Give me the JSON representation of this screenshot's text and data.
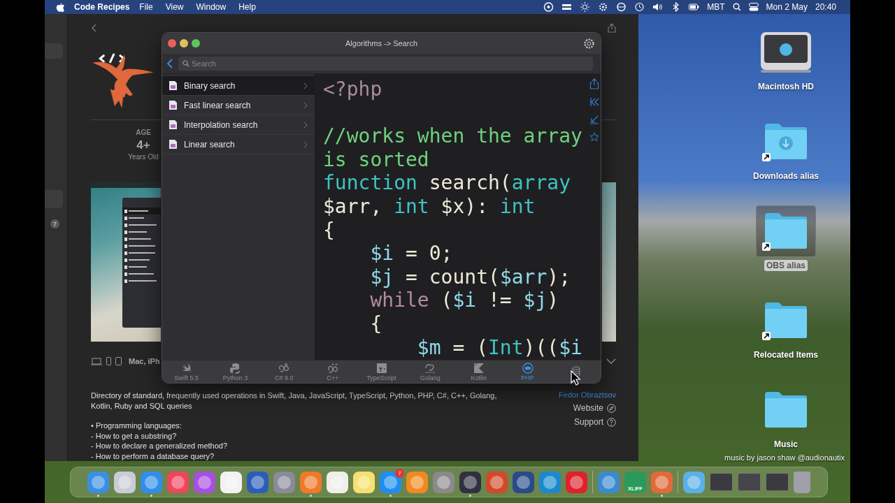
{
  "menu_bar": {
    "app_name": "Code Recipes",
    "menus": [
      "File",
      "View",
      "Window",
      "Help"
    ],
    "status_items": [
      {
        "kind": "ring"
      },
      {
        "kind": "stack"
      },
      {
        "kind": "sun"
      },
      {
        "kind": "gear"
      },
      {
        "kind": "circle"
      },
      {
        "kind": "clock"
      },
      {
        "kind": "speaker"
      },
      {
        "kind": "bluetooth"
      },
      {
        "kind": "battery"
      }
    ],
    "input_source": "MBT",
    "date": "Mon 2 May",
    "time": "20:40"
  },
  "app_store": {
    "sidebar_badge": "7",
    "age_label": "AGE",
    "age_value": "4+",
    "age_caption": "Years Old",
    "platforms": "Mac, iPh",
    "description": [
      "Directory of standard, frequently used operations in Swift, Java, JavaScript, TypeScript, Python, PHP, C#, C++, Golang, Kotlin, Ruby and SQL queries",
      "• Programming languages:",
      "- How to get a substring?",
      "- How to declare a generalized method?",
      "- How to perform a database query?"
    ],
    "developer": "Fedor Obraztsov",
    "links": [
      {
        "label": "Website",
        "kind": "compass"
      },
      {
        "label": "Support",
        "kind": "help"
      }
    ]
  },
  "code_window": {
    "title": "Algorithms -> Search",
    "search": {
      "placeholder": "Search"
    },
    "items": [
      {
        "label": "Binary search",
        "selected": true
      },
      {
        "label": "Fast linear search",
        "selected": false
      },
      {
        "label": "Interpolation search",
        "selected": false
      },
      {
        "label": "Linear search",
        "selected": false
      }
    ],
    "code": [
      {
        "kind": "code",
        "tokens": [
          {
            "kind": "tag",
            "text": "<?php"
          }
        ]
      },
      {
        "kind": "blank"
      },
      {
        "kind": "code",
        "tokens": [
          {
            "kind": "comment",
            "text": "//works when the array"
          }
        ]
      },
      {
        "kind": "code",
        "tokens": [
          {
            "kind": "comment",
            "text": "is sorted"
          }
        ]
      },
      {
        "kind": "code",
        "tokens": [
          {
            "kind": "keyword",
            "text": "function"
          },
          {
            "kind": "plain",
            "text": " search("
          },
          {
            "kind": "keyword",
            "text": "array"
          }
        ]
      },
      {
        "kind": "code",
        "tokens": [
          {
            "kind": "plain",
            "text": "$arr, "
          },
          {
            "kind": "keyword",
            "text": "int"
          },
          {
            "kind": "plain",
            "text": " $x): "
          },
          {
            "kind": "keyword",
            "text": "int"
          }
        ]
      },
      {
        "kind": "code",
        "tokens": [
          {
            "kind": "plain",
            "text": "{"
          }
        ]
      },
      {
        "kind": "code",
        "tokens": [
          {
            "kind": "variable",
            "text": "    $i"
          },
          {
            "kind": "plain",
            "text": " = 0;"
          }
        ]
      },
      {
        "kind": "code",
        "tokens": [
          {
            "kind": "variable",
            "text": "    $j"
          },
          {
            "kind": "plain",
            "text": " = count("
          },
          {
            "kind": "variable",
            "text": "$arr"
          },
          {
            "kind": "plain",
            "text": ");"
          }
        ]
      },
      {
        "kind": "code",
        "tokens": [
          {
            "kind": "control",
            "text": "    while"
          },
          {
            "kind": "plain",
            "text": " ("
          },
          {
            "kind": "variable",
            "text": "$i"
          },
          {
            "kind": "plain",
            "text": " != "
          },
          {
            "kind": "variable",
            "text": "$j"
          },
          {
            "kind": "plain",
            "text": ")"
          }
        ]
      },
      {
        "kind": "code",
        "tokens": [
          {
            "kind": "plain",
            "text": "    {"
          }
        ]
      },
      {
        "kind": "code",
        "tokens": [
          {
            "kind": "variable",
            "text": "        $m"
          },
          {
            "kind": "plain",
            "text": " = ("
          },
          {
            "kind": "keyword",
            "text": "Int"
          },
          {
            "kind": "plain",
            "text": ")(("
          },
          {
            "kind": "variable",
            "text": "$i"
          }
        ]
      }
    ],
    "tabs": [
      {
        "label": "Swift 5.5",
        "kind": "swift",
        "selected": false
      },
      {
        "label": "Python 3",
        "kind": "python",
        "selected": false
      },
      {
        "label": "C# 9.0",
        "kind": "csharp",
        "selected": false
      },
      {
        "label": "C++",
        "kind": "cpp",
        "selected": false
      },
      {
        "label": "TypeScript",
        "kind": "typescript",
        "selected": false
      },
      {
        "label": "Golang",
        "kind": "go",
        "selected": false
      },
      {
        "label": "Kotlin",
        "kind": "kotlin",
        "selected": false
      },
      {
        "label": "PHP",
        "kind": "php",
        "selected": true
      },
      {
        "kind": "database",
        "selected": false
      }
    ]
  },
  "desktop": {
    "icons": [
      {
        "label": "Macintosh HD",
        "kind": "drive",
        "alias": false,
        "selected": false
      },
      {
        "label": "Downloads alias",
        "kind": "downloads",
        "alias": true,
        "selected": false
      },
      {
        "label": "OBS alias",
        "kind": "folder",
        "alias": true,
        "selected": true
      },
      {
        "label": "Relocated Items",
        "kind": "folder",
        "alias": true,
        "selected": false
      },
      {
        "label": "Music",
        "kind": "folder",
        "alias": false,
        "selected": false
      }
    ],
    "caption": "music by jason shaw @audionautix"
  },
  "dock": {
    "items": [
      {
        "kind": "app",
        "color": "#3b8fe0",
        "running": true
      },
      {
        "kind": "app",
        "color": "#c9ccd6",
        "running": false
      },
      {
        "kind": "app",
        "color": "#2f8fe8",
        "running": true
      },
      {
        "kind": "app",
        "color": "#f0455a",
        "running": false
      },
      {
        "kind": "app",
        "color": "#a84ee0",
        "running": false
      },
      {
        "kind": "app",
        "color": "#f2f2f2",
        "running": false
      },
      {
        "kind": "app",
        "color": "#2b5db8",
        "running": false
      },
      {
        "kind": "app",
        "color": "#8a8a9a",
        "running": false
      },
      {
        "kind": "app",
        "color": "#f07a28",
        "running": true
      },
      {
        "kind": "app",
        "color": "#eeeeea",
        "running": false
      },
      {
        "kind": "app",
        "color": "#f5e070",
        "running": false
      },
      {
        "kind": "app",
        "color": "#1e8ff0",
        "running": true,
        "badge": "7"
      },
      {
        "kind": "app",
        "color": "#f08a20",
        "running": false
      },
      {
        "kind": "app",
        "color": "#8a8a8a",
        "running": false
      },
      {
        "kind": "app",
        "color": "#303040",
        "running": true
      },
      {
        "kind": "app",
        "color": "#d04a2a",
        "running": false
      },
      {
        "kind": "app",
        "color": "#2a4a8a",
        "running": false
      },
      {
        "kind": "app",
        "color": "#1a8ad0",
        "running": false
      },
      {
        "kind": "app",
        "color": "#e0202a",
        "running": false
      },
      {
        "kind": "separator"
      },
      {
        "kind": "app",
        "color": "#3a8ad0",
        "running": false
      },
      {
        "kind": "app",
        "color": "#2a9a5a",
        "running": false,
        "label": "XLIFF"
      },
      {
        "kind": "app",
        "color": "#e06a3a",
        "running": true
      },
      {
        "kind": "separator"
      },
      {
        "kind": "folder",
        "color": "#5ab0e8"
      },
      {
        "kind": "window",
        "color": "#3a3a40"
      },
      {
        "kind": "window",
        "color": "#44444a"
      },
      {
        "kind": "window",
        "color": "#3a3a40"
      },
      {
        "kind": "trash",
        "color": "#a0a0a8"
      }
    ]
  }
}
